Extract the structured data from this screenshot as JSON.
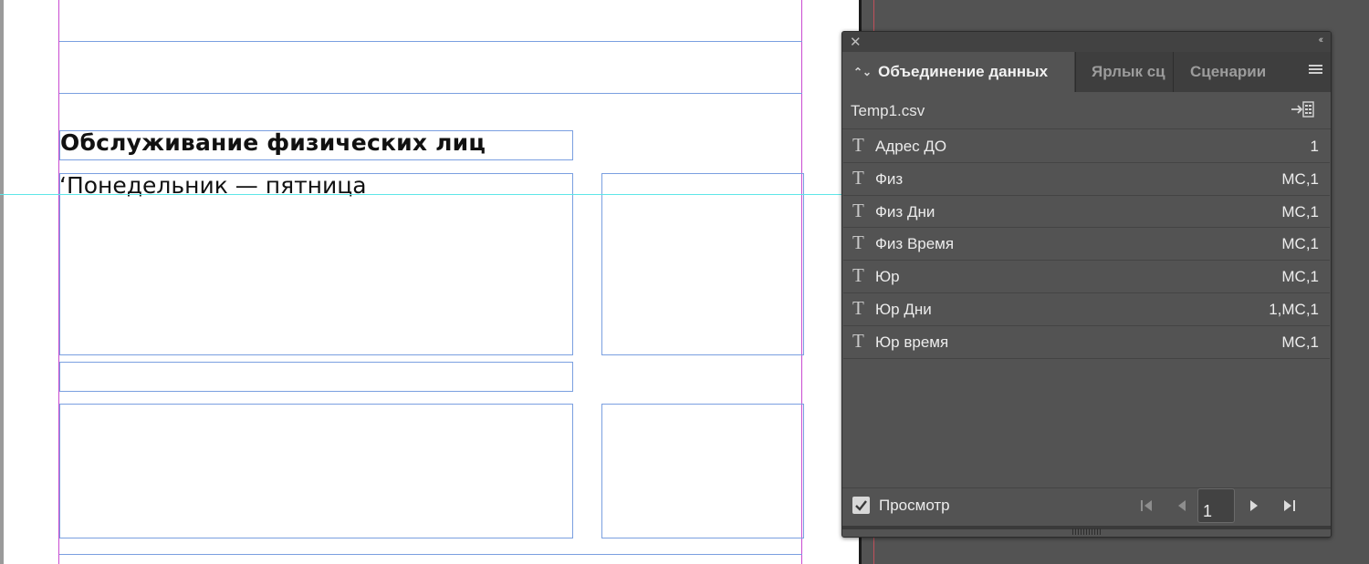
{
  "document": {
    "heading": "Обслуживание физических лиц",
    "body_line": "‘Понедельник — пятница"
  },
  "panel": {
    "tabs": [
      {
        "label": "Объединение данных",
        "active": true
      },
      {
        "label": "Ярлык сц",
        "active": false
      },
      {
        "label": "Сценарии",
        "active": false
      }
    ],
    "file_name": "Temp1.csv",
    "fields": [
      {
        "icon": "T",
        "name": "Адрес ДО",
        "value": "1"
      },
      {
        "icon": "T",
        "name": "Физ",
        "value": "МС,1"
      },
      {
        "icon": "T",
        "name": "Физ Дни",
        "value": "МС,1"
      },
      {
        "icon": "T",
        "name": "Физ Время",
        "value": "МС,1"
      },
      {
        "icon": "T",
        "name": "Юр",
        "value": "МС,1"
      },
      {
        "icon": "T",
        "name": "Юр Дни",
        "value": "1,МС,1"
      },
      {
        "icon": "T",
        "name": "Юр время",
        "value": "МС,1"
      }
    ],
    "preview": {
      "label": "Просмотр",
      "checked": true
    },
    "record_number": "1",
    "icons": {
      "close": "close-icon",
      "collapse": "collapse-double-chevron-icon",
      "menu": "panel-menu-icon",
      "import": "import-data-source-icon",
      "first": "first-record-icon",
      "prev": "previous-record-icon",
      "next": "next-record-icon",
      "last": "last-record-icon"
    }
  },
  "colors": {
    "frame_edge": "#7a9fe0",
    "margin_guide": "#c94bd1",
    "ruler_guide": "#5ee6e8",
    "panel_bg": "#535353"
  }
}
